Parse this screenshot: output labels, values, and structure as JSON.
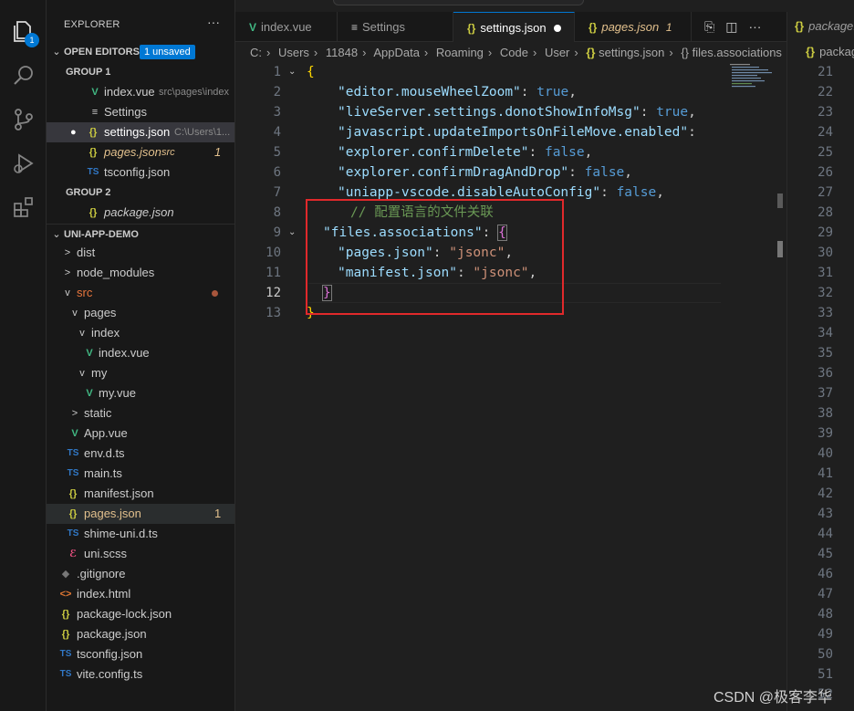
{
  "activity_bar": {
    "explorer_badge": "1"
  },
  "sidebar": {
    "title": "EXPLORER",
    "more": "···",
    "open_editors": {
      "label": "OPEN EDITORS",
      "badge": "1 unsaved",
      "group1": "GROUP 1",
      "group2": "GROUP 2",
      "items": [
        {
          "icon": "V",
          "name": "index.vue",
          "desc": "src\\pages\\index",
          "status": ""
        },
        {
          "icon": "≡",
          "name": "Settings",
          "desc": "",
          "status": ""
        },
        {
          "icon": "{}",
          "name": "settings.json",
          "desc": "C:\\Users\\1...",
          "status": "●"
        },
        {
          "icon": "{}",
          "name": "pages.json",
          "desc": "src",
          "status": "1"
        },
        {
          "icon": "TS",
          "name": "tsconfig.json",
          "desc": "",
          "status": ""
        },
        {
          "icon": "{}",
          "name": "package.json",
          "desc": "",
          "status": ""
        }
      ]
    },
    "project": {
      "label": "UNI-APP-DEMO",
      "items": [
        {
          "name": "dist",
          "icon": ">"
        },
        {
          "name": "node_modules",
          "icon": ">"
        },
        {
          "name": "src",
          "icon": "v"
        },
        {
          "name": "pages",
          "icon": "v"
        },
        {
          "name": "index",
          "icon": "v"
        },
        {
          "name": "index.vue",
          "icon": "V"
        },
        {
          "name": "my",
          "icon": "v"
        },
        {
          "name": "my.vue",
          "icon": "V"
        },
        {
          "name": "static",
          "icon": ">"
        },
        {
          "name": "App.vue",
          "icon": "V"
        },
        {
          "name": "env.d.ts",
          "icon": "TS"
        },
        {
          "name": "main.ts",
          "icon": "TS"
        },
        {
          "name": "manifest.json",
          "icon": "{}"
        },
        {
          "name": "pages.json",
          "icon": "{}",
          "status": "1"
        },
        {
          "name": "shime-uni.d.ts",
          "icon": "TS"
        },
        {
          "name": "uni.scss",
          "icon": "ℰ"
        },
        {
          "name": ".gitignore",
          "icon": "◆"
        },
        {
          "name": "index.html",
          "icon": "<>"
        },
        {
          "name": "package-lock.json",
          "icon": "{}"
        },
        {
          "name": "package.json",
          "icon": "{}"
        },
        {
          "name": "tsconfig.json",
          "icon": "TS"
        },
        {
          "name": "vite.config.ts",
          "icon": "TS"
        }
      ]
    }
  },
  "tabs": [
    {
      "icon": "V",
      "label": "index.vue"
    },
    {
      "icon": "≡",
      "label": "Settings"
    },
    {
      "icon": "{}",
      "label": "settings.json"
    },
    {
      "icon": "{}",
      "label": "pages.json",
      "status": "1"
    }
  ],
  "breadcrumb": [
    "C:",
    "Users",
    "11848",
    "AppData",
    "Roaming",
    "Code",
    "User",
    "settings.json",
    "files.associations"
  ],
  "breadcrumb_icons": {
    "file": "{}",
    "symbol": "{}"
  },
  "editor": {
    "line_numbers": [
      "1",
      "2",
      "3",
      "4",
      "5",
      "6",
      "7",
      "8",
      "9",
      "10",
      "11",
      "12",
      "13"
    ],
    "lines": [
      {
        "t": "{"
      },
      {
        "k": "\"editor.mouseWheelZoom\"",
        "v": "true",
        "vt": "b",
        "e": ","
      },
      {
        "k": "\"liveServer.settings.donotShowInfoMsg\"",
        "v": "true",
        "vt": "b",
        "e": ","
      },
      {
        "k": "\"javascript.updateImportsOnFileMove.enabled\"",
        "v": "",
        "vt": "b",
        "e": ""
      },
      {
        "k": "\"explorer.confirmDelete\"",
        "v": "false",
        "vt": "b",
        "e": ","
      },
      {
        "k": "\"explorer.confirmDragAndDrop\"",
        "v": "false",
        "vt": "b",
        "e": ","
      },
      {
        "k": "\"uniapp-vscode.disableAutoConfig\"",
        "v": "false",
        "vt": "b",
        "e": ","
      },
      {
        "comment": "// 配置语言的文件关联"
      },
      {
        "k": "\"files.associations\"",
        "v": "{",
        "vt": "br2",
        "e": ""
      },
      {
        "k": "\"pages.json\"",
        "v": "\"jsonc\"",
        "vt": "s",
        "e": ","
      },
      {
        "k": "\"manifest.json\"",
        "v": "\"jsonc\"",
        "vt": "s",
        "e": ","
      },
      {
        "t": "}"
      },
      {
        "t": "}"
      }
    ]
  },
  "right_pane": {
    "tab": "package.json",
    "crumb": "package.json",
    "line_numbers": [
      "21",
      "22",
      "23",
      "24",
      "25",
      "26",
      "27",
      "28",
      "29",
      "30",
      "31",
      "32",
      "33",
      "34",
      "35",
      "36",
      "37",
      "38",
      "39",
      "40",
      "41",
      "42",
      "43",
      "44",
      "45",
      "46",
      "47",
      "48",
      "49",
      "50",
      "51",
      "52"
    ]
  },
  "watermark": "CSDN @极客李华"
}
